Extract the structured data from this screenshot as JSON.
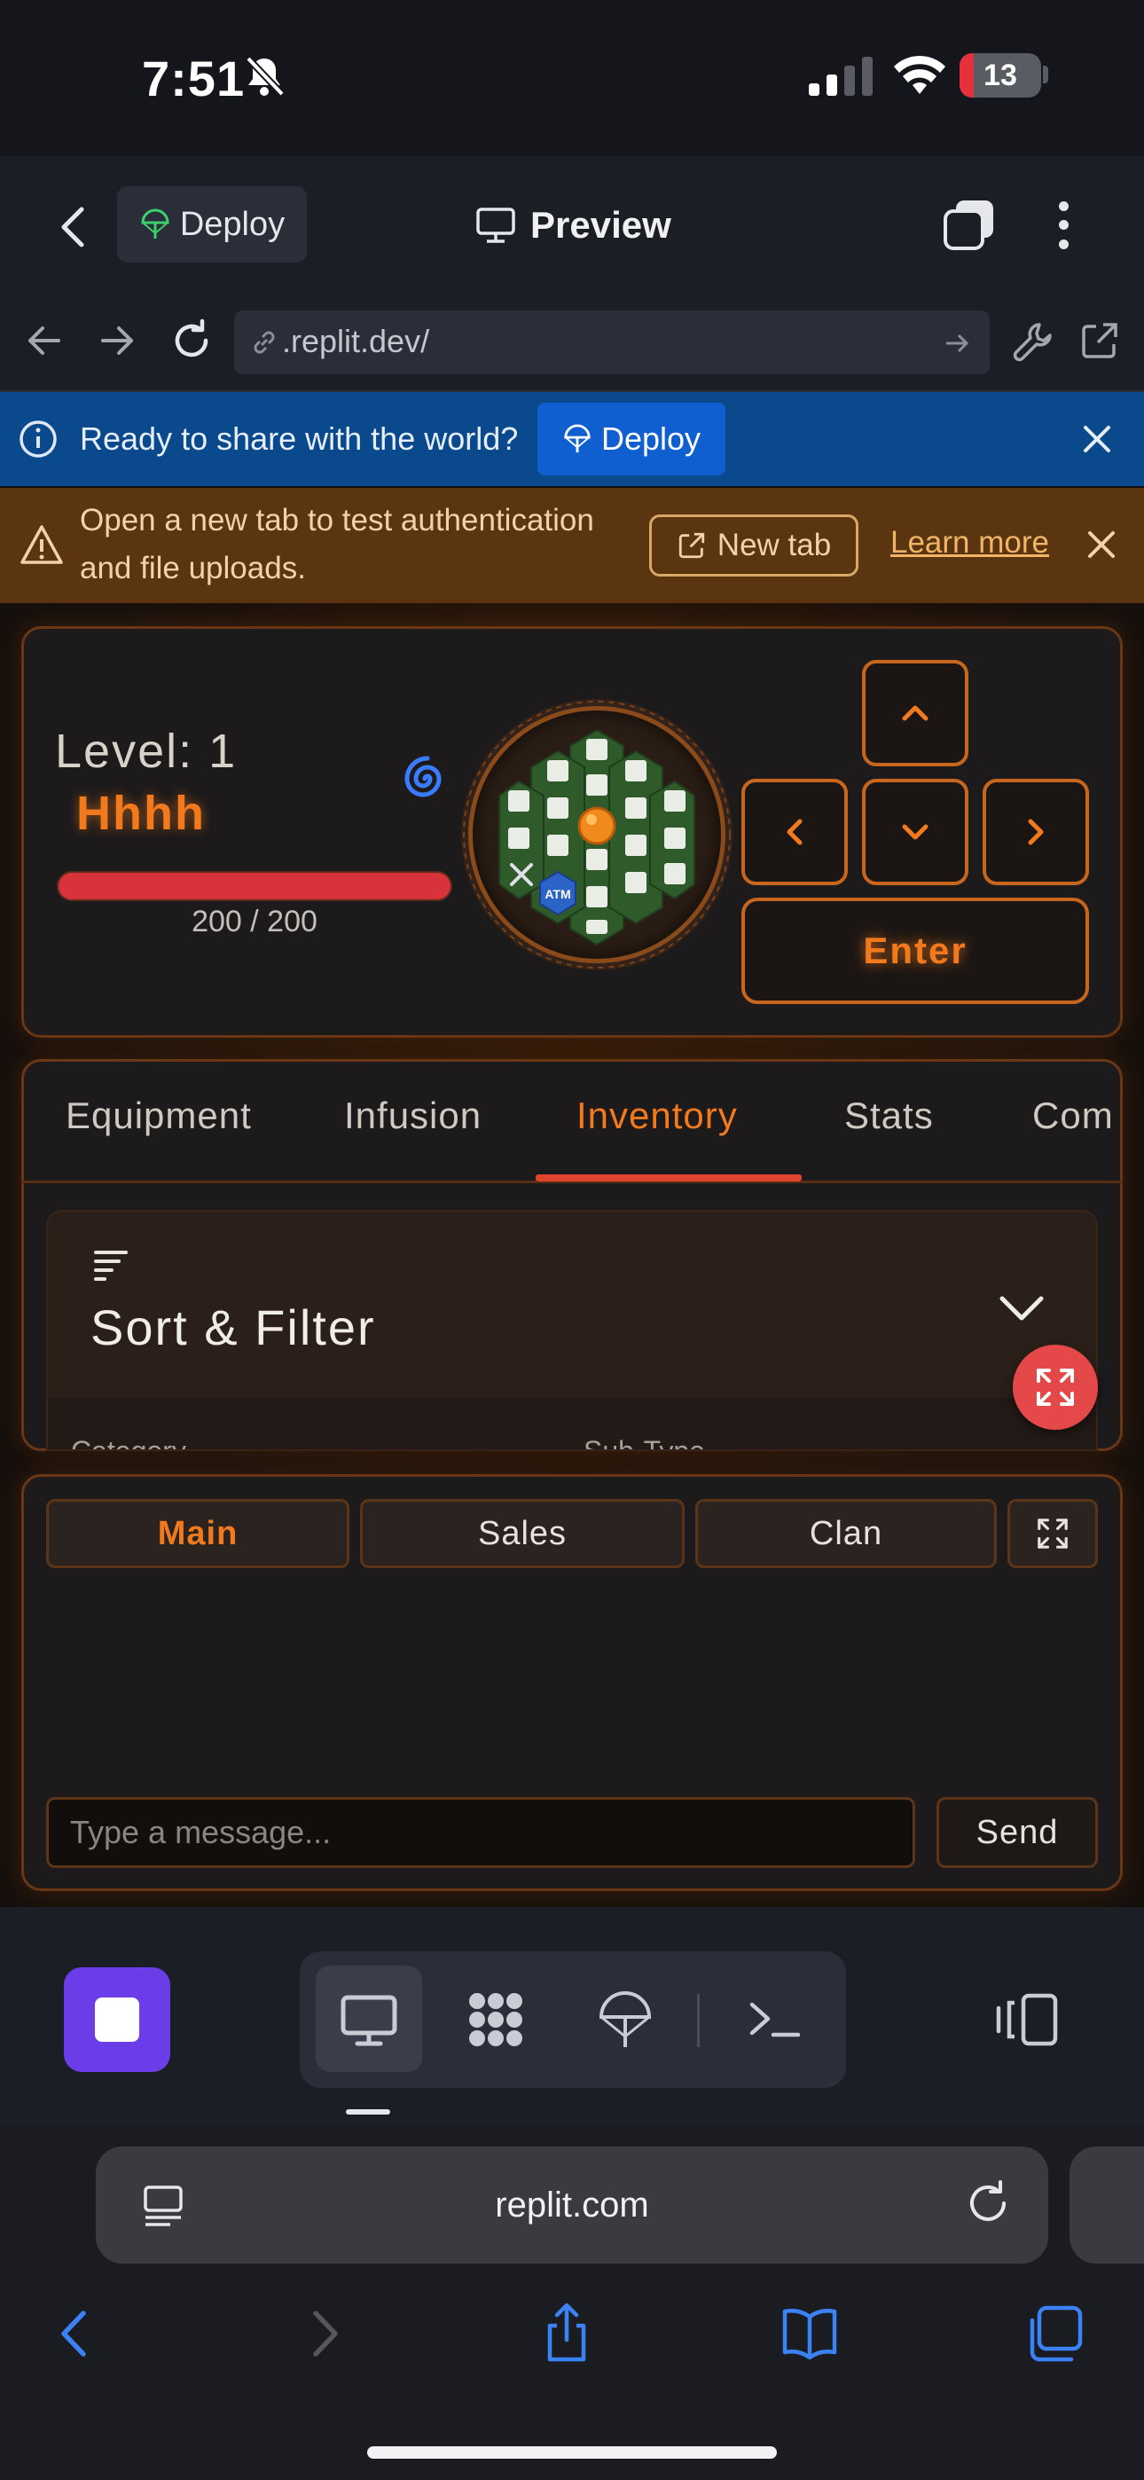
{
  "status_bar": {
    "time": "7:51",
    "battery": "13"
  },
  "replit_header": {
    "deploy_label": "Deploy",
    "preview_label": "Preview"
  },
  "browser": {
    "url": ".replit.dev/"
  },
  "deploy_banner": {
    "message": "Ready to share with the world?",
    "button": "Deploy"
  },
  "auth_banner": {
    "line1": "Open a new tab to test authentication",
    "line2": "and file uploads.",
    "new_tab": "New tab",
    "learn_more": "Learn more"
  },
  "player": {
    "level_label": "Level:",
    "level": "1",
    "name": "Hhhh",
    "hp_text": "200 / 200",
    "hp_fraction": 1.0
  },
  "controls": {
    "enter": "Enter"
  },
  "map": {
    "atm_label": "ATM"
  },
  "tabs": {
    "items": [
      "Equipment",
      "Infusion",
      "Inventory",
      "Stats",
      "Com"
    ],
    "active": "Inventory"
  },
  "sort_filter": {
    "title": "Sort & Filter",
    "category_label": "Category",
    "subtype_label": "Sub-Type"
  },
  "chat": {
    "channels": [
      "Main",
      "Sales",
      "Clan"
    ],
    "active": "Main",
    "placeholder": "Type a message...",
    "send": "Send"
  },
  "safari": {
    "address": "replit.com"
  },
  "colors": {
    "accent": "#f27a1d",
    "hp": "#d8323a",
    "stop": "#6a3de8",
    "banner_blue": "#0a4a8c",
    "banner_orange": "#5b3510"
  }
}
